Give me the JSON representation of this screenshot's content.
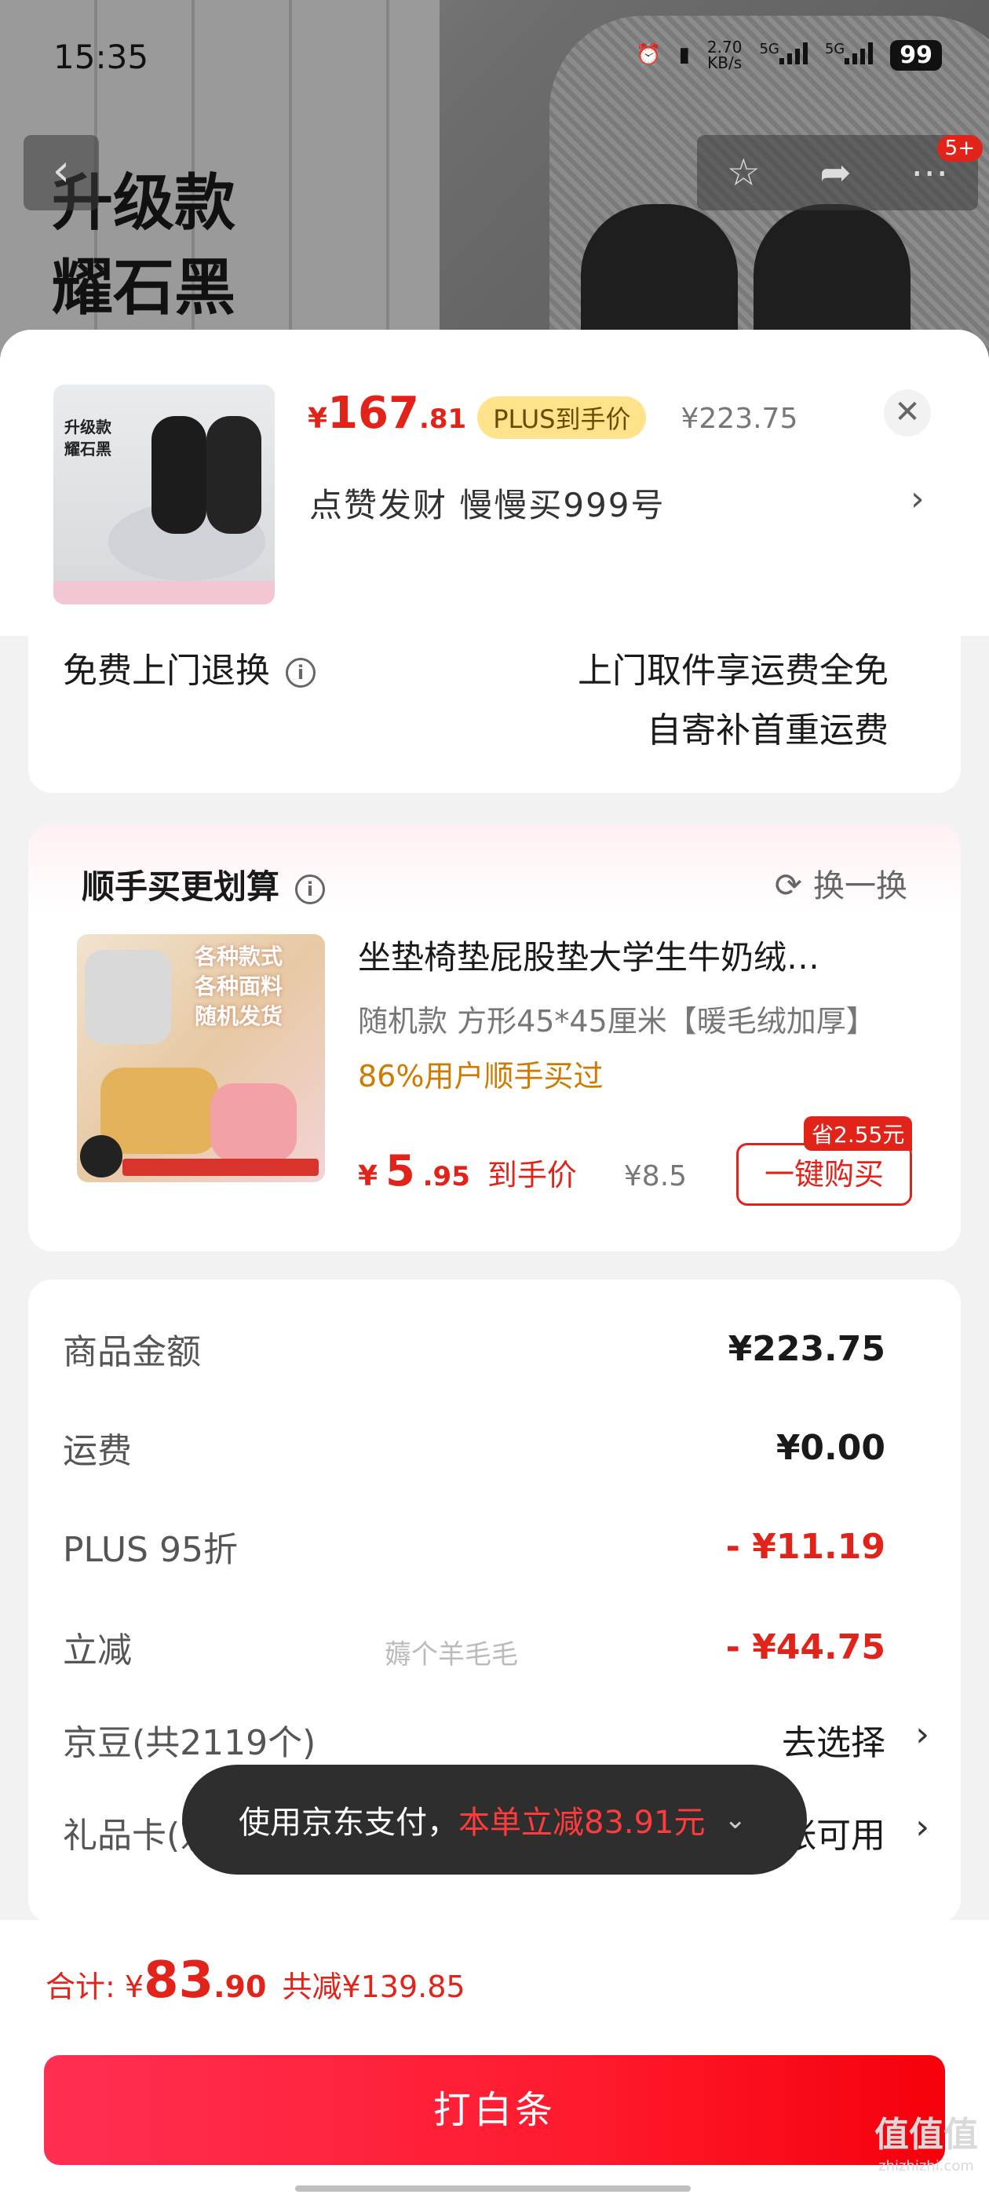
{
  "status_bar": {
    "time": "15:35",
    "net_speed_value": "2.70",
    "net_speed_unit": "KB/s",
    "signal_1": "5G",
    "signal_2": "5G",
    "battery": "99"
  },
  "hero": {
    "title_line1": "升级款",
    "title_line2": "耀石黑"
  },
  "nav": {
    "back_icon": "chevron-left-icon",
    "favorite_icon": "star-icon",
    "share_icon": "share-icon",
    "more_icon": "more-icon",
    "badge": "5+"
  },
  "product": {
    "thumb_title_line1": "升级款",
    "thumb_title_line2": "耀石黑",
    "currency": "¥",
    "price_int": "167",
    "price_dec": ".81",
    "plus_tag": "PLUS到手价",
    "original_price": "¥223.75",
    "spec": "点赞发财  慢慢买999号"
  },
  "return_service": {
    "label": "免费上门退换",
    "line1": "上门取件享运费全免",
    "line2": "自寄补首重运费"
  },
  "addon": {
    "title": "顺手买更划算",
    "swap_label": "换一换",
    "image_text_line1": "各种款式",
    "image_text_line2": "各种面料",
    "image_text_line3": "随机发货",
    "name": "坐垫椅垫屁股垫大学生牛奶绒…",
    "spec": "随机款  方形45*45厘米【暖毛绒加厚】",
    "rate": "86%用户顺手买过",
    "currency": "¥",
    "price_int": "5",
    "price_dec": ".95",
    "price_suffix": "到手价",
    "original_price": "¥8.5",
    "save_tag": "省2.55元",
    "buy_label": "一键购买"
  },
  "bill": {
    "rows": [
      {
        "label": "商品金额",
        "value": "¥223.75"
      },
      {
        "label": "运费",
        "value": "¥0.00"
      },
      {
        "label": "PLUS 95折",
        "value": "- ¥11.19"
      },
      {
        "label": "立减",
        "value": "- ¥44.75"
      },
      {
        "label": "京豆(共2119个)",
        "value": "去选择"
      },
      {
        "label": "礼品卡(京东卡/E卡)",
        "value": "5张可用"
      }
    ],
    "overlay_text": "薅个羊毛毛"
  },
  "toast": {
    "text": "使用京东支付，",
    "highlight": "本单立减83.91元"
  },
  "footer": {
    "total_label": "合计: ¥",
    "total_int": "83",
    "total_dec": ".90",
    "discount": "共减¥139.85",
    "pay_label": "打白条"
  },
  "watermark": {
    "main": "值值值",
    "sub": "zhizhizhi.com"
  },
  "colors": {
    "accent_red": "#e2231a",
    "plus_yellow": "#ffe28a",
    "rate_orange": "#d07a00"
  }
}
